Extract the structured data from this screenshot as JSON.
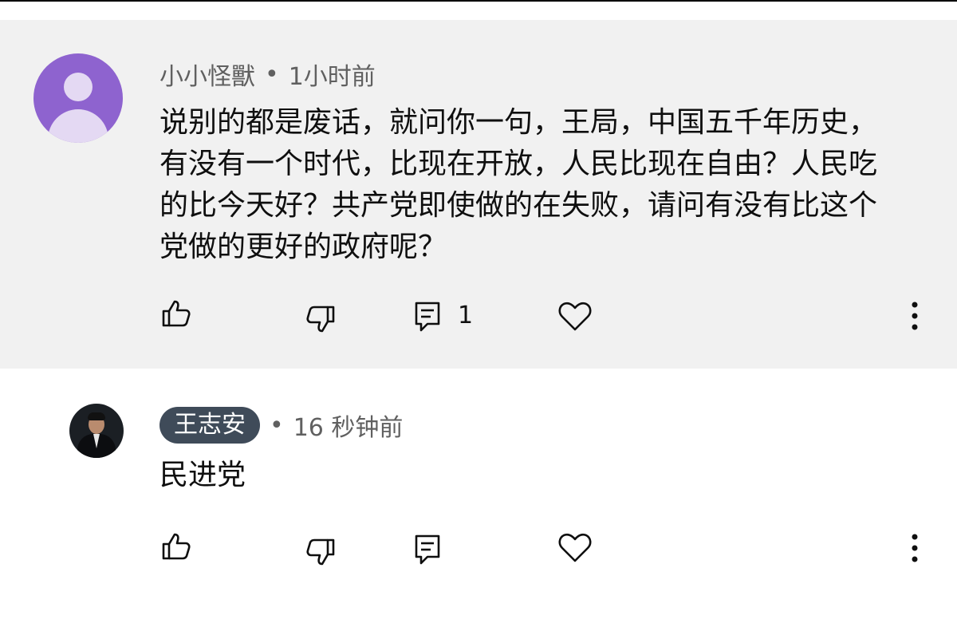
{
  "comments": [
    {
      "author": "小小怪獸",
      "separator": "•",
      "time": "1小时前",
      "text": "说别的都是废话，就问你一句，王局，中国五千年历史，有没有一个时代，比现在开放，人民比现在自由？人民吃的比今天好？共产党即使做的在失败，请问有没有比这个党做的更好的政府呢？",
      "reply_count": "1",
      "avatar": "default-user-avatar",
      "highlighted": true
    },
    {
      "author": "王志安",
      "separator": "•",
      "time": "16 秒钟前",
      "text": "民进党",
      "avatar": "photo-avatar",
      "author_is_creator": true
    }
  ],
  "icons": {
    "like": "thumbs-up-icon",
    "dislike": "thumbs-down-icon",
    "reply": "comment-icon",
    "heart": "heart-icon",
    "more": "more-vertical-icon"
  },
  "colors": {
    "highlight_bg": "#f1f1f1",
    "meta_text": "#606060",
    "badge_bg": "#3f4b59",
    "avatar_default": "#8e63cf"
  }
}
